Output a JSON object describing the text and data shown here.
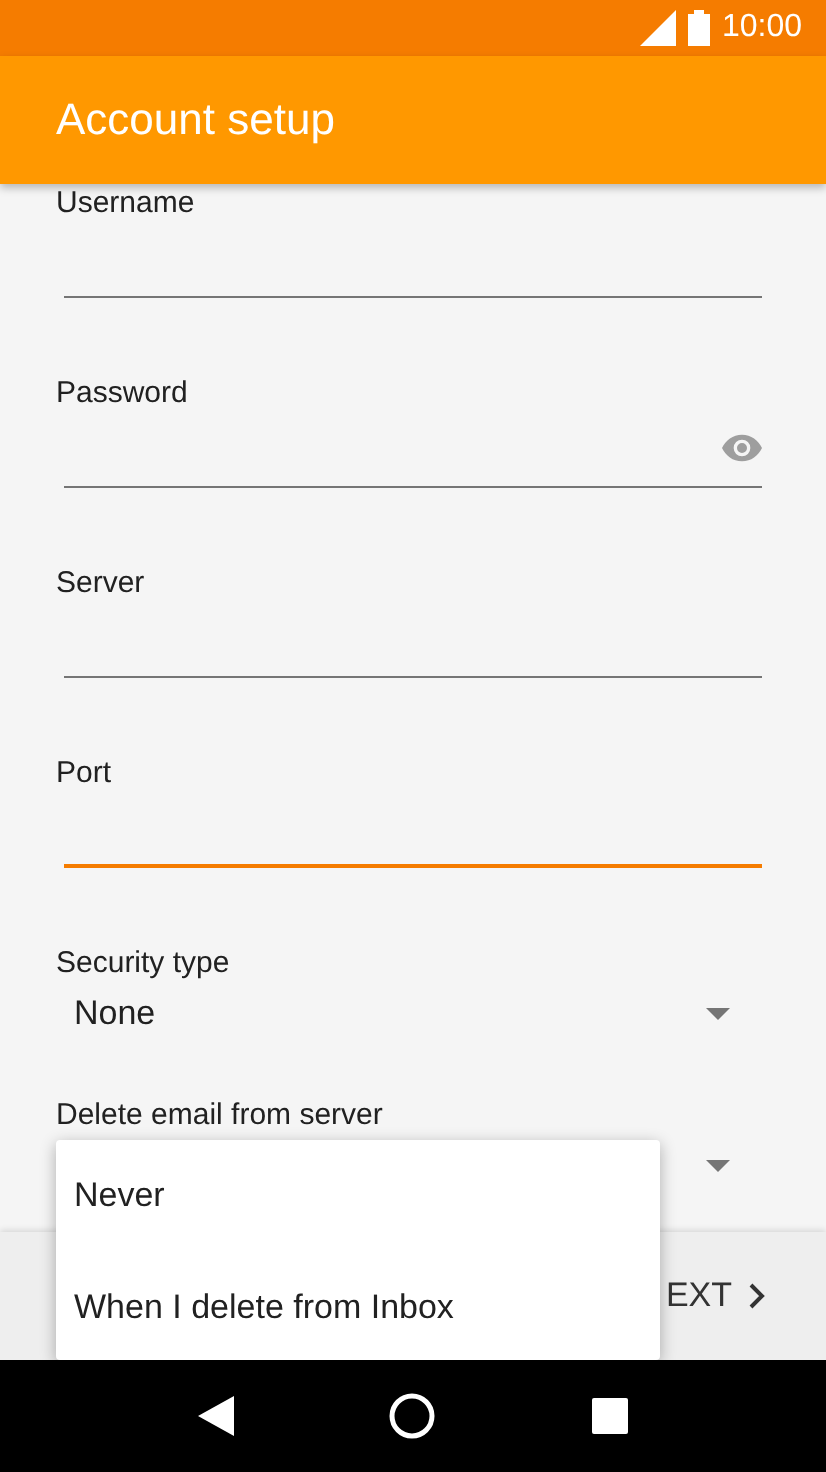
{
  "status_bar": {
    "time": "10:00"
  },
  "app_bar": {
    "title": "Account setup"
  },
  "fields": [
    {
      "kind": "text",
      "label": "Username",
      "focused": false
    },
    {
      "kind": "password",
      "label": "Password",
      "focused": false
    },
    {
      "kind": "text",
      "label": "Server",
      "focused": false
    },
    {
      "kind": "text",
      "label": "Port",
      "focused": true
    },
    {
      "kind": "select",
      "label": "Security type",
      "value": "None"
    },
    {
      "kind": "select",
      "label": "Delete email from server"
    }
  ],
  "next_button": {
    "label": "EXT"
  },
  "dropdown_menu": {
    "options": [
      {
        "label": "Never"
      },
      {
        "label": "When I delete from Inbox"
      }
    ]
  }
}
